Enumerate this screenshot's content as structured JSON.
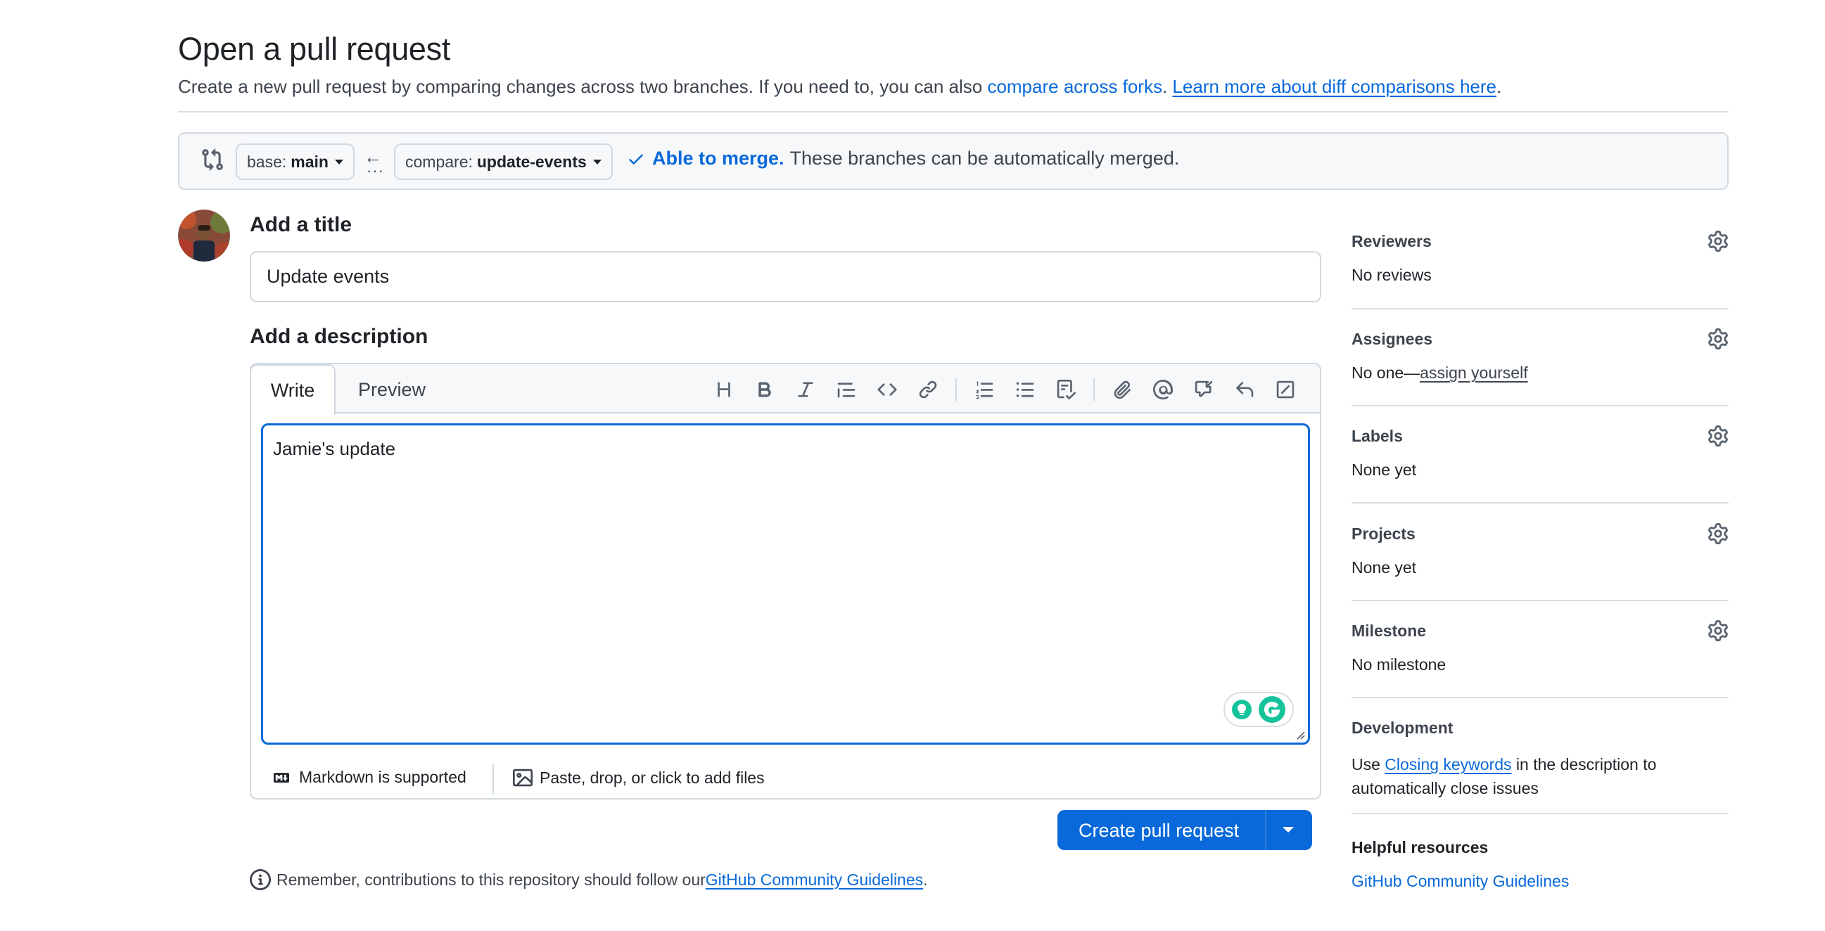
{
  "header": {
    "title": "Open a pull request",
    "subtitle_prefix": "Create a new pull request by comparing changes across two branches. If you need to, you can also ",
    "compare_forks_link": "compare across forks",
    "subtitle_mid": ". ",
    "learn_more_link": "Learn more about diff comparisons here",
    "subtitle_suffix": "."
  },
  "range": {
    "base_label": "base:",
    "base_value": "main",
    "compare_label": "compare:",
    "compare_value": "update-events",
    "merge_ok": "Able to merge.",
    "merge_msg": "These branches can be automatically merged."
  },
  "form": {
    "title_label": "Add a title",
    "title_value": "Update events",
    "description_label": "Add a description",
    "tab_write": "Write",
    "tab_preview": "Preview",
    "description_value": "Jamie's update",
    "markdown_hint": "Markdown is supported",
    "files_hint": "Paste, drop, or click to add files",
    "create_button": "Create pull request",
    "reminder_prefix": "Remember, contributions to this repository should follow our ",
    "reminder_link": "GitHub Community Guidelines",
    "reminder_suffix": "."
  },
  "toolbar": {
    "icons": [
      "heading-icon",
      "bold-icon",
      "italic-icon",
      "quote-icon",
      "code-icon",
      "link-icon",
      "numbered-list-icon",
      "bulleted-list-icon",
      "task-list-icon",
      "attach-icon",
      "mention-icon",
      "cross-reference-icon",
      "saved-reply-icon",
      "slash-commands-icon"
    ]
  },
  "sidebar": {
    "reviewers": {
      "title": "Reviewers",
      "value": "No reviews"
    },
    "assignees": {
      "title": "Assignees",
      "value_prefix": "No one—",
      "value_link": "assign yourself"
    },
    "labels": {
      "title": "Labels",
      "value": "None yet"
    },
    "projects": {
      "title": "Projects",
      "value": "None yet"
    },
    "milestone": {
      "title": "Milestone",
      "value": "No milestone"
    },
    "development": {
      "title": "Development",
      "text_prefix": "Use ",
      "link": "Closing keywords",
      "text_suffix": " in the description to automatically close issues"
    },
    "helpful": {
      "title": "Helpful resources",
      "link": "GitHub Community Guidelines"
    }
  },
  "colors": {
    "accent": "#0969da",
    "grammarly_green": "#15c39a"
  }
}
